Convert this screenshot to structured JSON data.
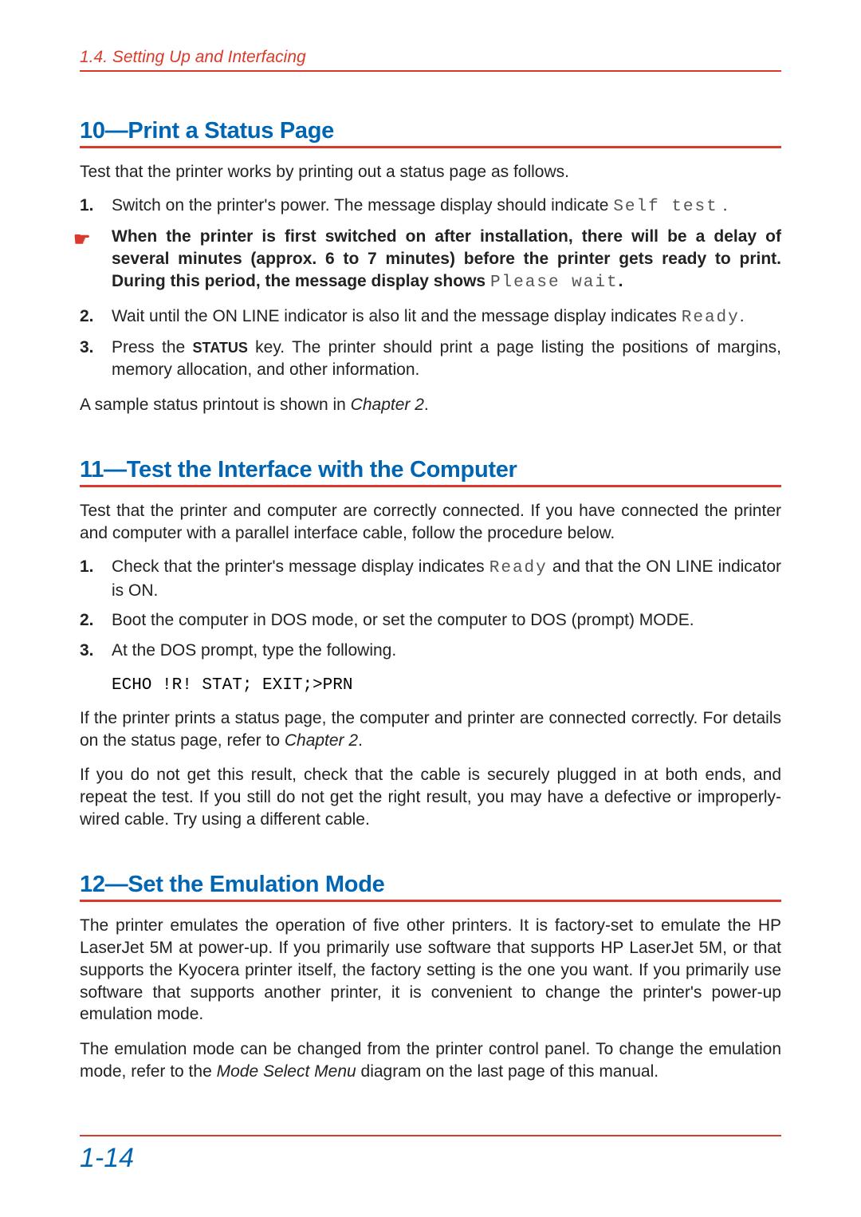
{
  "header": "1.4.  Setting Up and Interfacing",
  "section10": {
    "title": "10—Print a Status Page",
    "intro": "Test that the printer works by printing out a status page as follows.",
    "step1_a": "Switch on the printer's power. The message display should indicate ",
    "step1_lcd": "Self test",
    "step1_b": " .",
    "note_a": "When the printer is first switched on after installation, there will be a delay of several minutes (approx. 6 to 7 minutes) before the printer gets ready to print. During this period, the message display shows ",
    "note_lcd": "Please wait",
    "note_b": ".",
    "step2_a": "Wait until the ON LINE indicator is also lit and the message display indicates ",
    "step2_lcd": "Ready",
    "step2_b": ".",
    "step3_a": "Press the ",
    "step3_key": "STATUS",
    "step3_b": " key. The printer should print a page listing the positions of margins, memory allocation, and other information.",
    "outro_a": "A sample status printout is shown in ",
    "outro_i": "Chapter 2",
    "outro_b": "."
  },
  "section11": {
    "title": "11—Test the Interface with the Computer",
    "intro": "Test that the printer and computer are correctly connected. If you have connected the printer and computer with a parallel interface cable, follow the procedure below.",
    "step1_a": "Check that the printer's message display indicates ",
    "step1_lcd": "Ready",
    "step1_b": " and that the ON LINE indicator is ON.",
    "step2": "Boot the computer in DOS mode, or set the computer to DOS (prompt) MODE.",
    "step3": "At the DOS prompt, type the following.",
    "code": "ECHO !R! STAT; EXIT;>PRN",
    "after1_a": "If the printer prints a status page, the computer and printer are connected correctly. For details on the status page, refer to ",
    "after1_i": "Chapter 2",
    "after1_b": ".",
    "after2": "If you do not get this result, check that the cable is securely plugged in at both ends, and repeat the test. If you still do not get the right result, you may have a defective or improperly-wired cable. Try using a different cable."
  },
  "section12": {
    "title": "12—Set the Emulation Mode",
    "para1": "The printer emulates the operation of five other printers. It is factory-set to emulate the HP LaserJet 5M at power-up. If you primarily use software that supports HP LaserJet 5M, or that supports the Kyocera printer itself, the factory setting is the one you want. If you primarily use software that supports another printer, it is convenient to change the printer's power-up emulation mode.",
    "para2_a": "The emulation mode can be changed from the printer control panel. To change the emulation mode, refer to the ",
    "para2_i": "Mode Select Menu",
    "para2_b": " diagram on the last page of this manual."
  },
  "pageNumber": "1-14",
  "numbers": {
    "n1": "1.",
    "n2": "2.",
    "n3": "3."
  }
}
